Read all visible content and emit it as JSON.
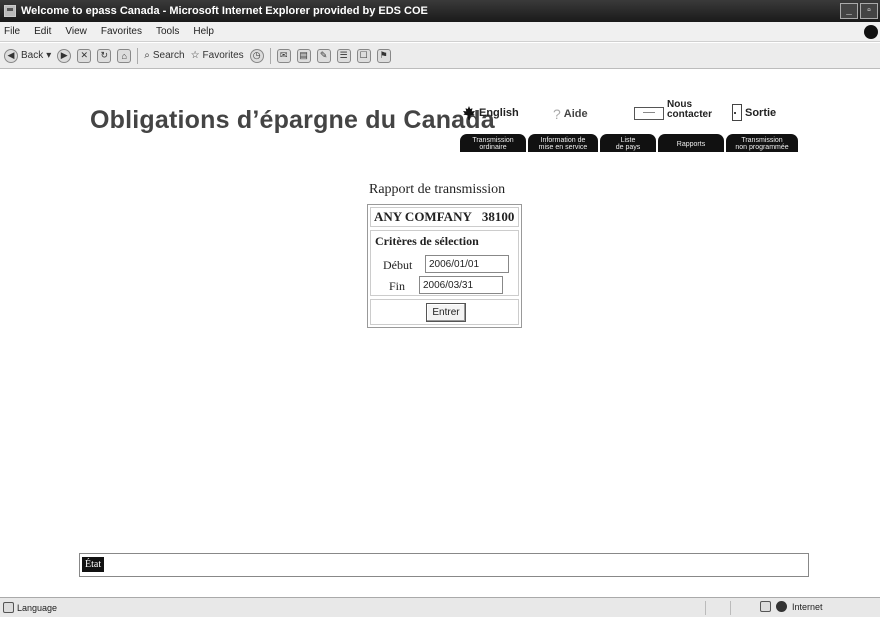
{
  "window": {
    "title": "Welcome to epass Canada - Microsoft Internet Explorer provided by EDS COE",
    "controls": [
      "_",
      "▫",
      "✕"
    ]
  },
  "menu": [
    "File",
    "Edit",
    "View",
    "Favorites",
    "Tools",
    "Help"
  ],
  "toolbar": {
    "back": "Back",
    "search": "Search",
    "favorites": "Favorites"
  },
  "page": {
    "site_title": "Obligations d’épargne du Canada",
    "util_links": {
      "english": "English",
      "aide": "Aide",
      "contact_line1": "Nous",
      "contact_line2": "contacter",
      "sortie": "Sortie"
    },
    "nav_tabs": [
      {
        "line1": "Transmission",
        "line2": "ordinaire"
      },
      {
        "line1": "Information de",
        "line2": "mise en service"
      },
      {
        "line1": "Liste",
        "line2": "de pays"
      },
      {
        "line1": "Rapports",
        "line2": ""
      },
      {
        "line1": "Transmission",
        "line2": "non programmée"
      }
    ],
    "report": {
      "heading": "Rapport de transmission",
      "company": "ANY COMFANY",
      "company_number": "38100",
      "criteria_title": "Critères de sélection",
      "start_label": "Début",
      "start_value": "2006/01/01",
      "end_label": "Fin",
      "end_value": "2006/03/31",
      "submit_label": "Entrer"
    },
    "etat_label": "État"
  },
  "statusbar": {
    "left": "Language",
    "zone": "Internet"
  }
}
